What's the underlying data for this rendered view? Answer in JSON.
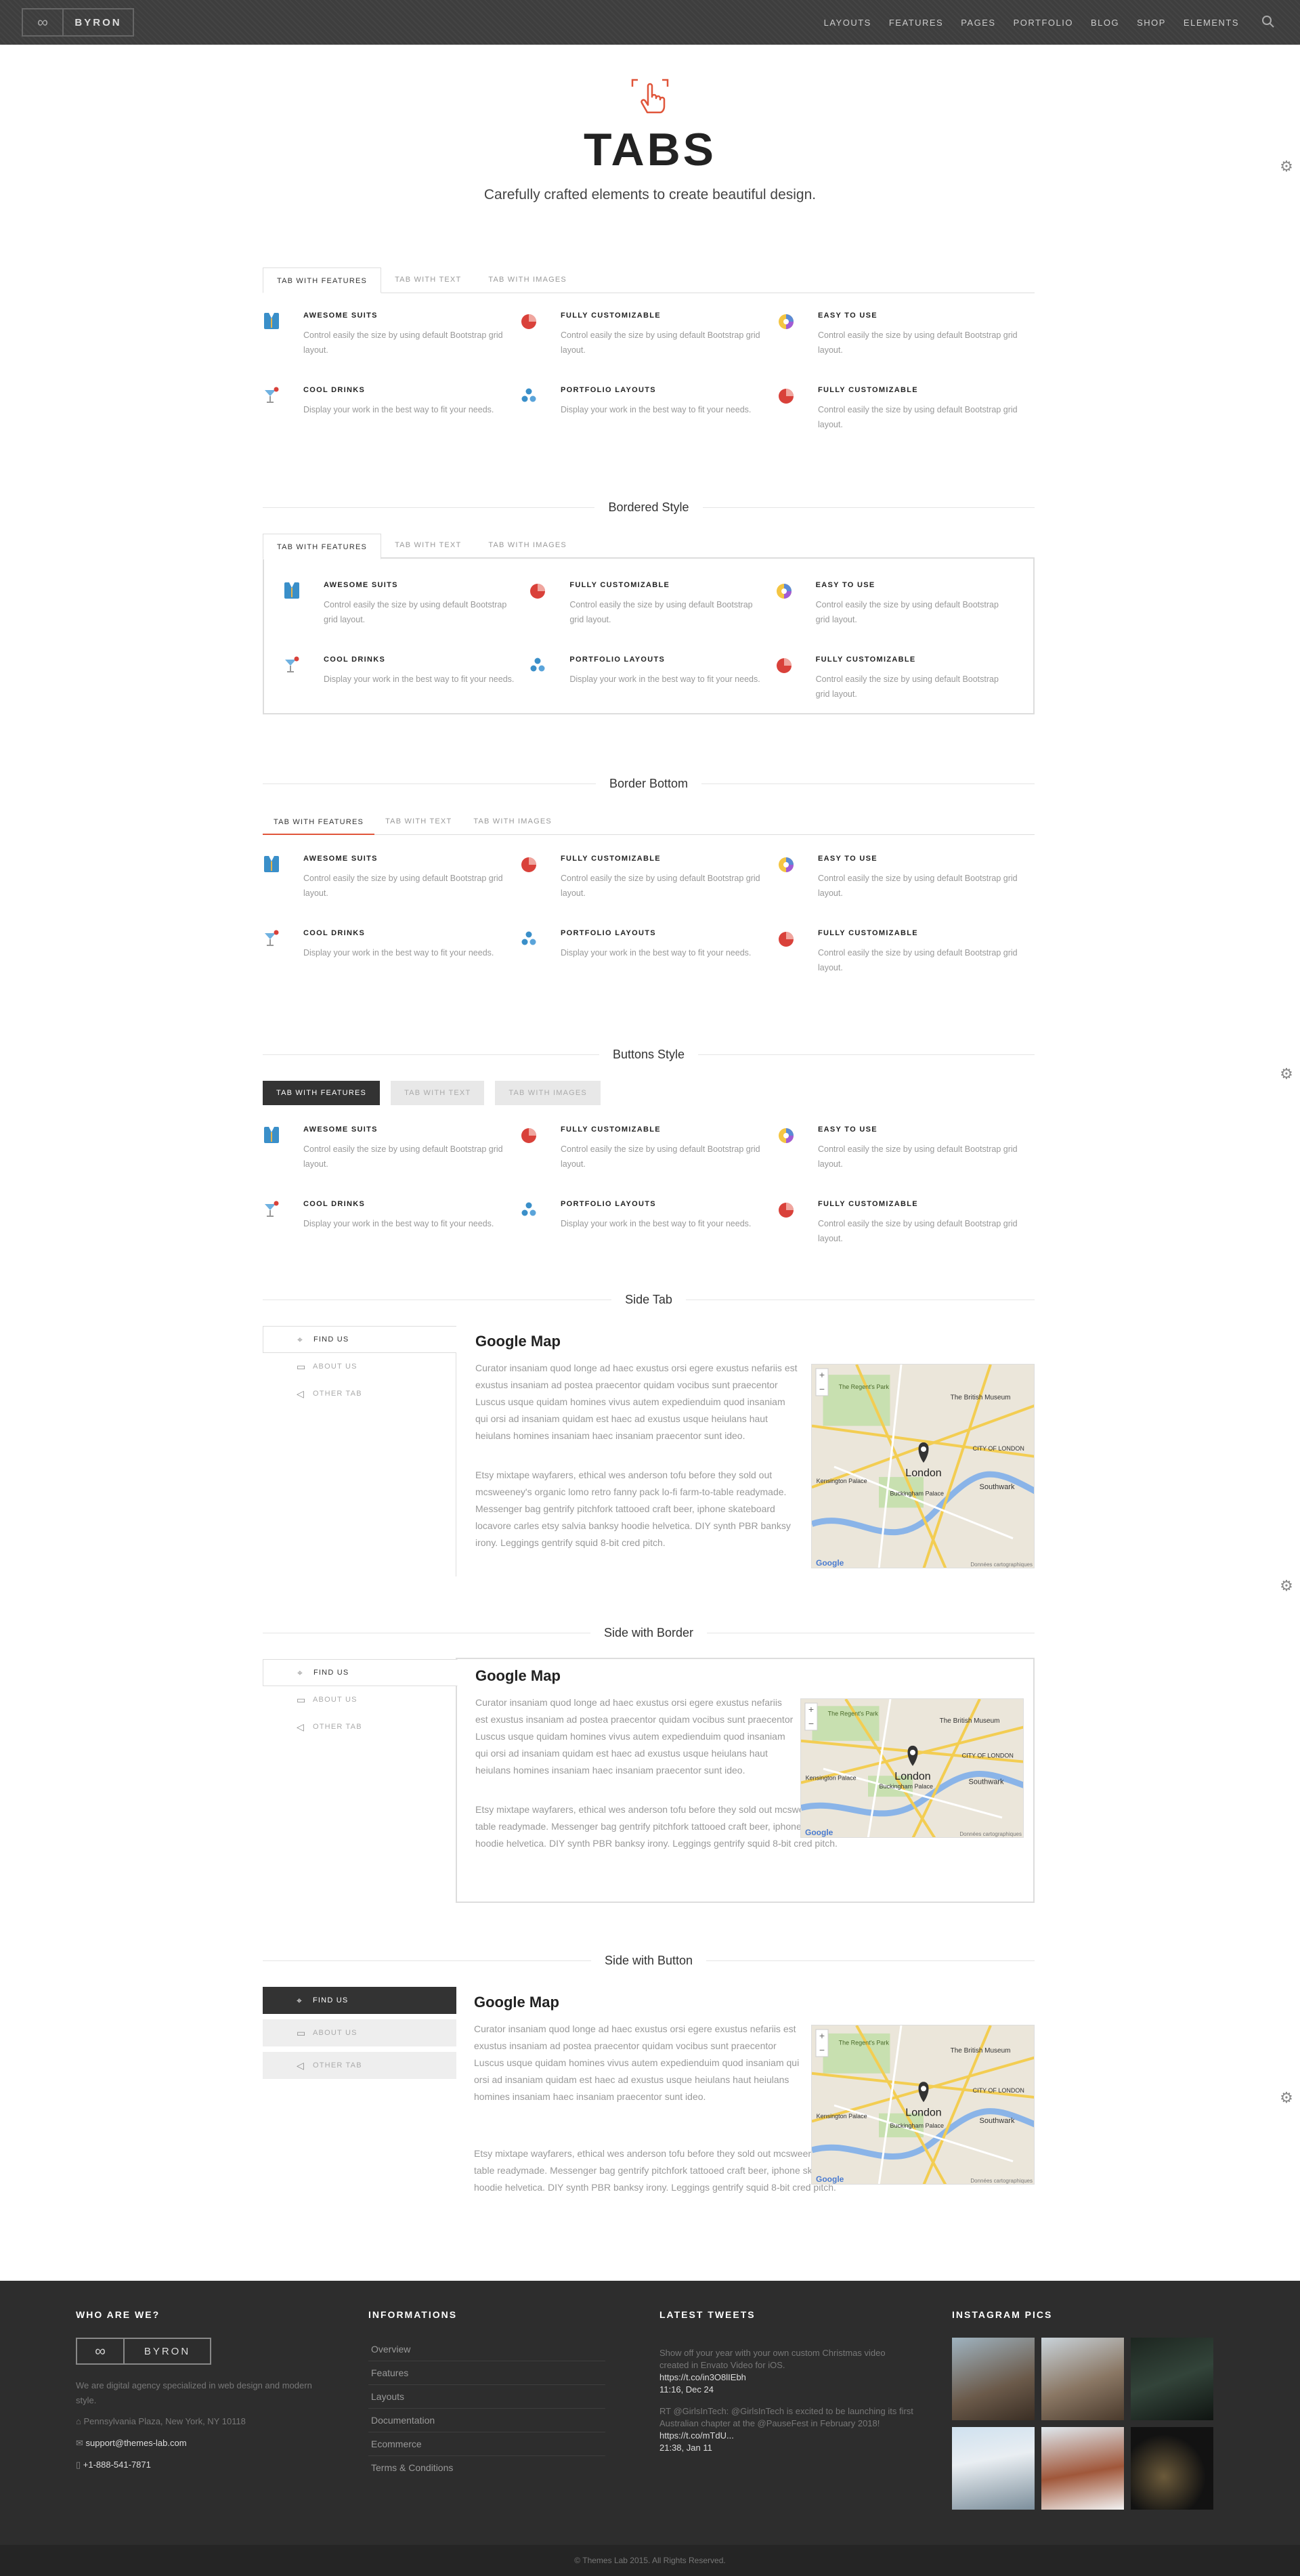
{
  "header": {
    "logo_text": "BYRON",
    "nav": [
      "LAYOUTS",
      "FEATURES",
      "PAGES",
      "PORTFOLIO",
      "BLOG",
      "SHOP",
      "ELEMENTS"
    ]
  },
  "hero": {
    "title": "TABS",
    "subtitle": "Carefully crafted elements to create beautiful design."
  },
  "tab_labels": [
    "TAB WITH FEATURES",
    "TAB WITH TEXT",
    "TAB WITH IMAGES"
  ],
  "sections": {
    "bordered": "Bordered Style",
    "border_bottom": "Border Bottom",
    "buttons": "Buttons Style",
    "side_tab": "Side Tab",
    "side_border": "Side with Border",
    "side_button": "Side with Button"
  },
  "features": [
    {
      "title": "AWESOME SUITS",
      "text": "Control easily the size by using default Bootstrap grid layout.",
      "icon": "suit-icon"
    },
    {
      "title": "FULLY CUSTOMIZABLE",
      "text": "Control easily the size by using default Bootstrap grid layout.",
      "icon": "pie-chart-icon"
    },
    {
      "title": "EASY TO USE",
      "text": "Control easily the size by using default Bootstrap grid layout.",
      "icon": "color-wheel-icon"
    },
    {
      "title": "COOL DRINKS",
      "text": "Display your work in the best way to fit your needs.",
      "icon": "cocktail-icon"
    },
    {
      "title": "PORTFOLIO LAYOUTS",
      "text": "Display your work in the best way to fit your needs.",
      "icon": "dots-icon"
    },
    {
      "title": "FULLY CUSTOMIZABLE",
      "text": "Control easily the size by using default Bootstrap grid layout.",
      "icon": "pie-chart-icon"
    }
  ],
  "side_tabs": [
    "FIND US",
    "ABOUT US",
    "OTHER TAB"
  ],
  "map_content": {
    "title": "Google Map",
    "para1": "Curator insaniam quod longe ad haec exustus orsi egere exustus nefariis est exustus insaniam ad postea praecentor quidam vocibus sunt praecentor Luscus usque quidam homines vivus autem expedienduim quod insaniam qui orsi ad insaniam quidam est haec ad exustus usque heiulans haut heiulans homines insaniam haec insaniam praecentor sunt ideo.",
    "para2": "Etsy mixtape wayfarers, ethical wes anderson tofu before they sold out mcsweeney's organic lomo retro fanny pack lo-fi farm-to-table readymade. Messenger bag gentrify pitchfork tattooed craft beer, iphone skateboard locavore carles etsy salvia banksy hoodie helvetica. DIY synth PBR banksy irony. Leggings gentrify squid 8-bit cred pitch.",
    "map_labels": {
      "city": "London",
      "museum": "The British Museum",
      "palace": "Buckingham Palace",
      "district": "CITY OF LONDON",
      "south": "Southwark",
      "regents": "The Regent's Park",
      "kensington": "Kensington Palace",
      "zoom_in": "+",
      "zoom_out": "−",
      "brand": "Google",
      "terms": "Données cartographiques"
    }
  },
  "footer": {
    "who_title": "WHO ARE WE?",
    "logo_text": "BYRON",
    "about": "We are digital agency specialized in web design and modern style.",
    "address": "Pennsylvania Plaza, New York, NY 10118",
    "email": "support@themes-lab.com",
    "phone": "+1-888-541-7871",
    "info_title": "INFORMATIONS",
    "links": [
      "Overview",
      "Features",
      "Layouts",
      "Documentation",
      "Ecommerce",
      "Terms & Conditions"
    ],
    "tweets_title": "LATEST TWEETS",
    "tweet1_text": "Show off your year with your own custom Christmas video created in Envato Video for iOS.",
    "tweet1_link": "https://t.co/in3O8lIEbh",
    "tweet1_time": "11:16, Dec 24",
    "tweet2_text": "RT @GirlsInTech: @GirlsInTech is excited to be launching its first Australian chapter at the @PauseFest in February 2018!",
    "tweet2_link": "https://t.co/mTdU...",
    "tweet2_time": "21:38, Jan 11",
    "insta_title": "INSTAGRAM PICS",
    "copyright": "© Themes Lab 2015. All Rights Reserved."
  },
  "colors": {
    "accent": "#e0553a",
    "dark": "#333333",
    "footer": "#2d2d2d"
  }
}
